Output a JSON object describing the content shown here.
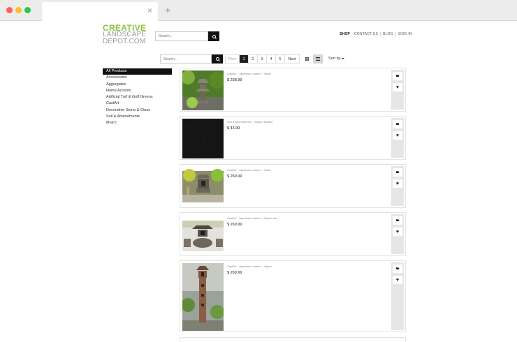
{
  "browser": {
    "tab_close": "×",
    "new_tab": "+"
  },
  "site": {
    "logo": [
      "CREATIVE",
      "LANDSCAPE",
      "DEPOT.COM"
    ],
    "header_search_placeholder": "Search...",
    "nav": [
      "SHOP",
      "CONTACT US",
      "BLOG",
      "SIGN IN"
    ],
    "nav_active": "SHOP"
  },
  "toolbar": {
    "search_placeholder": "Search...",
    "prev": "Prev",
    "pages": [
      "1",
      "2",
      "3",
      "4",
      "5"
    ],
    "current_page": "1",
    "next": "Next",
    "sort_label": "Sort by",
    "view_mode": "list"
  },
  "sidebar": {
    "items": [
      "All Products",
      "Accessories",
      "Aggregates",
      "Home Accents",
      "Artificial Turf & Golf Greens",
      "CastArt",
      "Decorative Stone & Glass",
      "Soil & Amendments",
      "Mulch"
    ],
    "active": "All Products"
  },
  "products": [
    {
      "meta": "CastArt · Japanese Lantern · Hikari",
      "price": "$ 238.99"
    },
    {
      "meta": "Soil & Amendments · Garden Builder",
      "price": "$ 43.99"
    },
    {
      "meta": "CastArt · Japanese Lantern · Kokin",
      "price": "$ 269.99"
    },
    {
      "meta": "CastArt · Japanese Lantern · Mayhiruka",
      "price": "$ 269.99"
    },
    {
      "meta": "CastArt · Japanese Lantern · Yagna",
      "price": "$ 269.99"
    }
  ],
  "colors": {
    "logo_green": "#8dc63f",
    "active_dark": "#111111"
  },
  "icons": [
    "search-icon",
    "grid-view-icon",
    "list-view-icon",
    "cart-icon",
    "heart-icon",
    "close-icon",
    "plus-icon"
  ]
}
